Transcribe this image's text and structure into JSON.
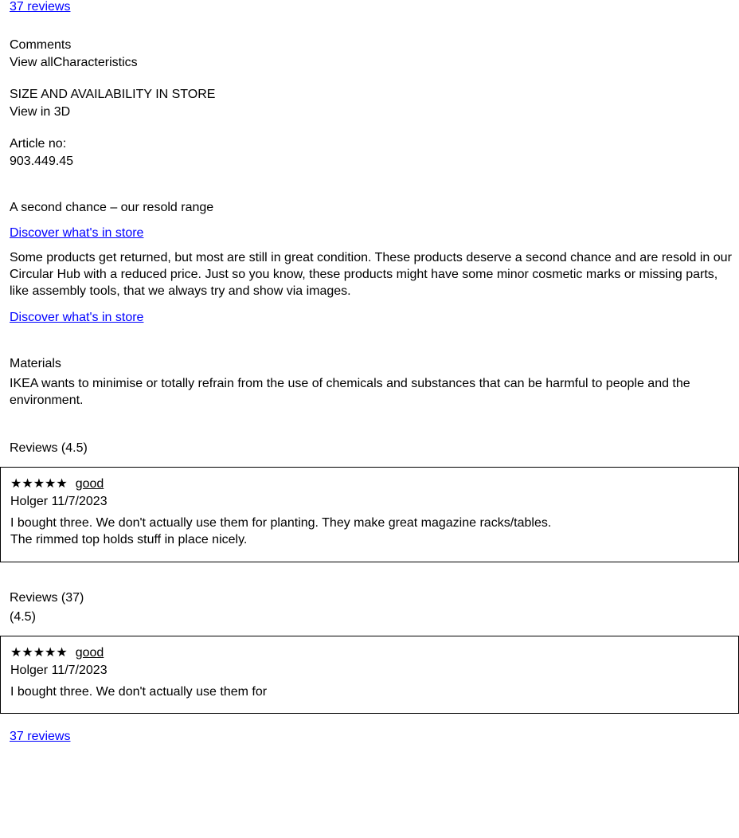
{
  "topLink": "37 reviews",
  "product": {
    "comments": "Comments",
    "characteristicsLine": "View allCharacteristics",
    "sizeAvailability": "SIZE AND AVAILABILITY IN STORE",
    "viewIn3d": "View in 3D",
    "articleNo": "Article no:",
    "articleNoValue": "903.449.45"
  },
  "recovery": {
    "title": "A second chance – our resold range",
    "linkLabel": "Discover what's in store",
    "body": "Some products get returned, but most are still in great condition. These products deserve a second chance and are resold in our Circular Hub with a reduced price. Just so you know, these products might have some minor cosmetic marks or missing parts, like assembly tools, that we always try and show via images."
  },
  "materials": {
    "heading": "Materials",
    "blurb": "IKEA wants to minimise or totally refrain from the use of chemicals and substances that can be harmful to people and the environment."
  },
  "reviewsHeading": "Reviews",
  "rating": "(4.5)",
  "review1": {
    "stars": "★★★★★",
    "summary": "good",
    "author": "Holger",
    "date": "11/7/2023",
    "line1": "I bought three. We don't actually use them for planting. They make great magazine racks/tables.",
    "line2": "The rimmed top holds stuff in place nicely."
  },
  "reviewsSection": {
    "heading": "Reviews",
    "reviewCount": "(37)",
    "rating": "(4.5)"
  },
  "review2": {
    "stars": "★★★★★",
    "summary": "good",
    "author": "Holger",
    "date": "11/7/2023",
    "line": "I bought three. We don't actually use them for"
  },
  "moreReviews": "37 reviews"
}
